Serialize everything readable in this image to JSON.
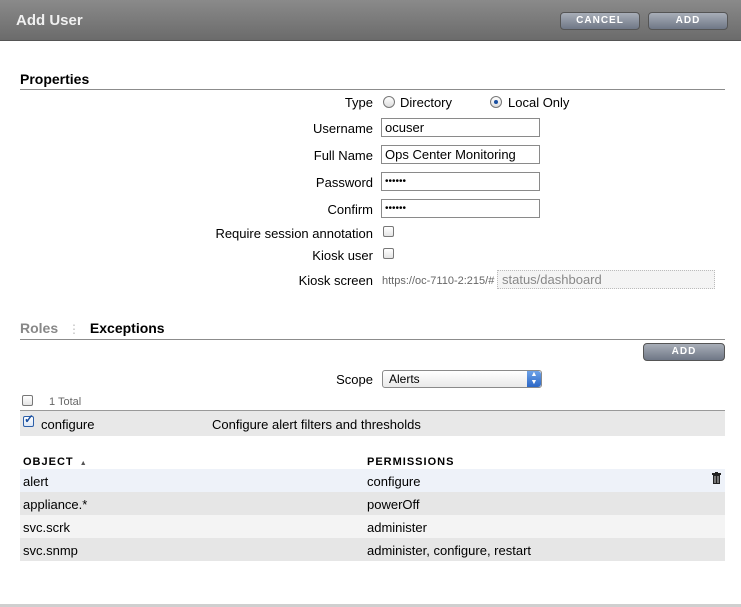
{
  "dialog": {
    "title": "Add User",
    "cancel_label": "CANCEL",
    "add_label": "ADD"
  },
  "properties": {
    "heading": "Properties",
    "type_label": "Type",
    "type_options": [
      "Directory",
      "Local Only"
    ],
    "type_selected": "Local Only",
    "username_label": "Username",
    "username_value": "ocuser",
    "fullname_label": "Full Name",
    "fullname_value": "Ops Center Monitoring",
    "password_label": "Password",
    "password_value": "••••••",
    "confirm_label": "Confirm",
    "confirm_value": "••••••",
    "require_annotation_label": "Require session annotation",
    "require_annotation_checked": false,
    "kiosk_user_label": "Kiosk user",
    "kiosk_user_checked": false,
    "kiosk_screen_label": "Kiosk screen",
    "kiosk_screen_prefix": "https://oc-7110-2:215/#",
    "kiosk_screen_value": "status/dashboard"
  },
  "tabs": {
    "roles": "Roles",
    "exceptions": "Exceptions",
    "active": "Exceptions"
  },
  "exceptions": {
    "add_label": "ADD",
    "scope_label": "Scope",
    "scope_value": "Alerts",
    "total_text": "1 Total",
    "item": {
      "name": "configure",
      "description": "Configure alert filters and thresholds",
      "checked": true
    }
  },
  "object_table": {
    "col_object": "OBJECT",
    "sort_indicator": "▲",
    "col_permissions": "PERMISSIONS",
    "rows": [
      {
        "object": "alert",
        "permissions": "configure"
      },
      {
        "object": "appliance.*",
        "permissions": "powerOff"
      },
      {
        "object": "svc.scrk",
        "permissions": "administer"
      },
      {
        "object": "svc.snmp",
        "permissions": "administer, configure, restart"
      }
    ]
  },
  "colors": {
    "titlebar": "#767676",
    "button": "#7d8594",
    "row_highlight": "#e8edf6",
    "row_alt": "#e6e6e6"
  }
}
